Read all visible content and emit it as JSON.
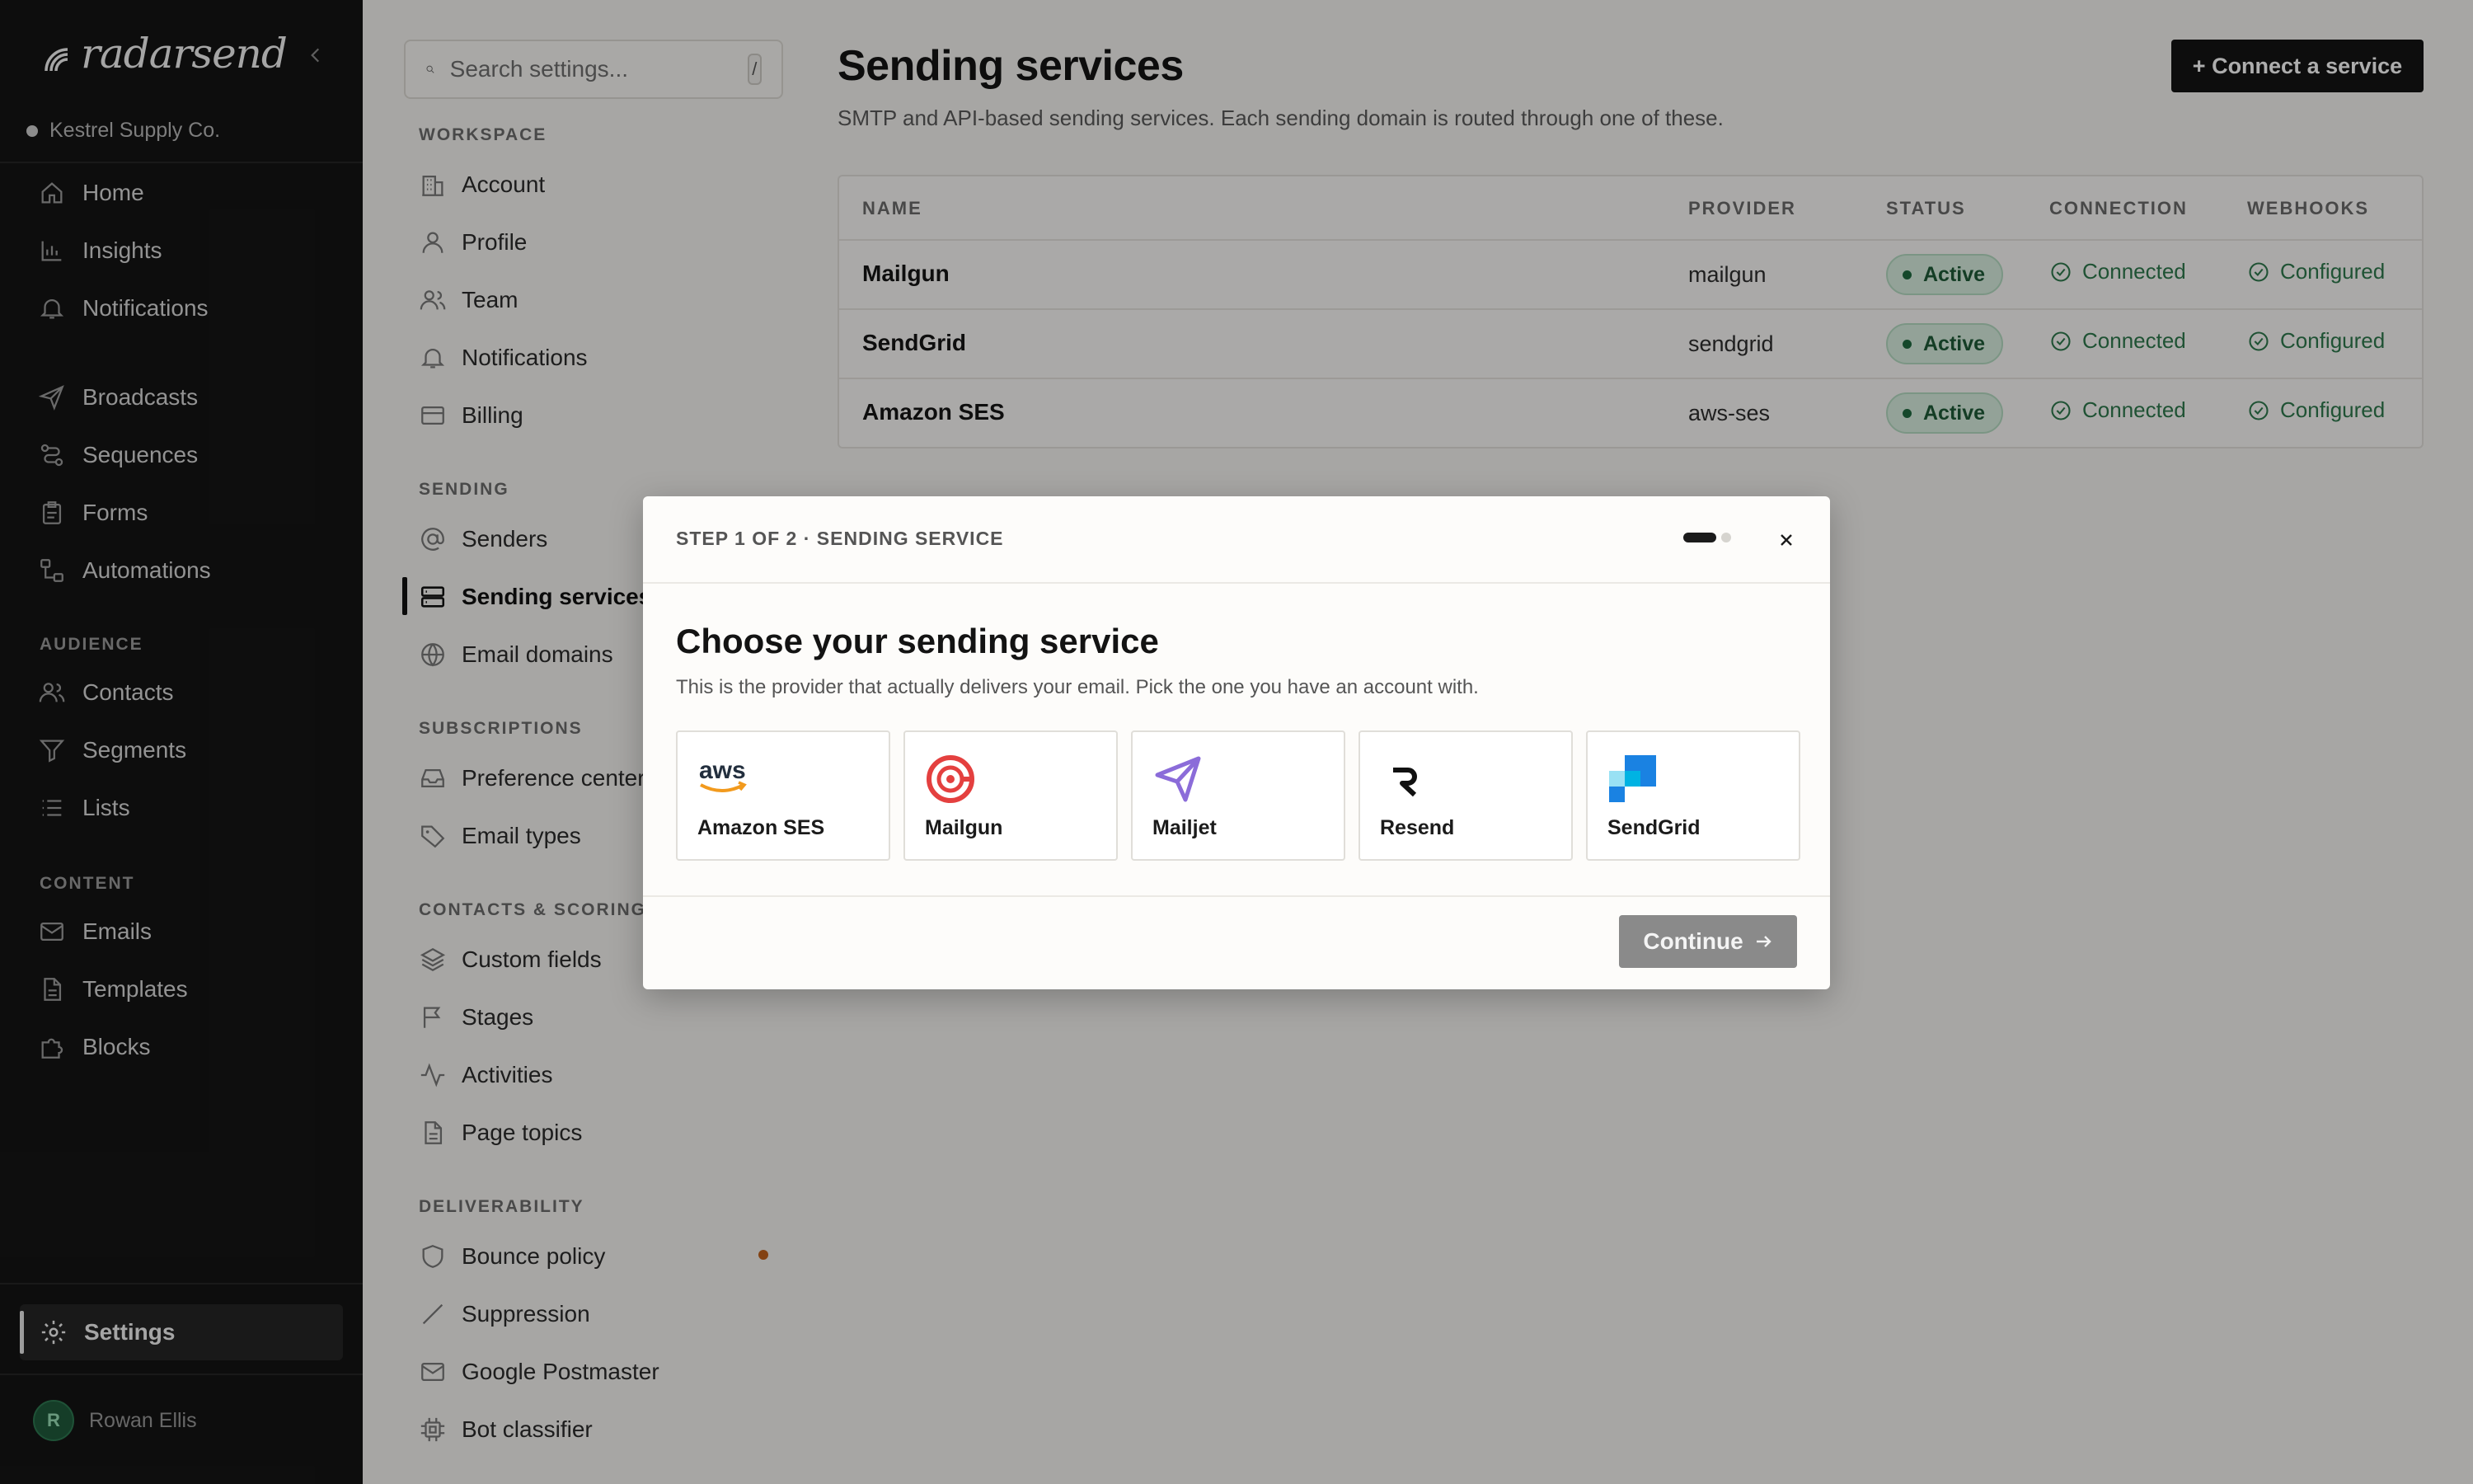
{
  "brand": {
    "name": "radarsend"
  },
  "workspace": {
    "name": "Kestrel Supply Co."
  },
  "nav": {
    "primary": [
      {
        "label": "Home",
        "icon": "home-icon"
      },
      {
        "label": "Insights",
        "icon": "bar-chart-icon"
      },
      {
        "label": "Notifications",
        "icon": "bell-icon"
      }
    ],
    "outreach": [
      {
        "label": "Broadcasts",
        "icon": "send-icon"
      },
      {
        "label": "Sequences",
        "icon": "sequence-icon"
      },
      {
        "label": "Forms",
        "icon": "clipboard-icon"
      },
      {
        "label": "Automations",
        "icon": "workflow-icon"
      }
    ],
    "audience_title": "AUDIENCE",
    "audience": [
      {
        "label": "Contacts",
        "icon": "users-icon"
      },
      {
        "label": "Segments",
        "icon": "filter-icon"
      },
      {
        "label": "Lists",
        "icon": "list-icon"
      }
    ],
    "content_title": "CONTENT",
    "content": [
      {
        "label": "Emails",
        "icon": "mail-icon"
      },
      {
        "label": "Templates",
        "icon": "file-icon"
      },
      {
        "label": "Blocks",
        "icon": "puzzle-icon"
      }
    ],
    "settings_label": "Settings"
  },
  "user": {
    "name": "Rowan Ellis",
    "initial": "R"
  },
  "settings_nav": {
    "search_placeholder": "Search settings...",
    "search_shortcut": "/",
    "workspace_title": "WORKSPACE",
    "workspace": [
      "Account",
      "Profile",
      "Team",
      "Notifications",
      "Billing"
    ],
    "sending_title": "SENDING",
    "sending": [
      "Senders",
      "Sending services",
      "Email domains"
    ],
    "subscriptions_title": "SUBSCRIPTIONS",
    "subscriptions": [
      "Preference center",
      "Email types"
    ],
    "contacts_title": "CONTACTS & SCORING",
    "contacts": [
      "Custom fields",
      "Stages",
      "Activities",
      "Page topics"
    ],
    "deliverability_title": "DELIVERABILITY",
    "deliverability": [
      "Bounce policy",
      "Suppression",
      "Google Postmaster",
      "Bot classifier"
    ]
  },
  "page": {
    "title": "Sending services",
    "subtitle": "SMTP and API-based sending services. Each sending domain is routed through one of these.",
    "connect_button": "+ Connect a service"
  },
  "table": {
    "columns": [
      "NAME",
      "PROVIDER",
      "STATUS",
      "CONNECTION",
      "WEBHOOKS"
    ],
    "rows": [
      {
        "name": "Mailgun",
        "provider": "mailgun",
        "status": "Active",
        "connection": "Connected",
        "webhooks": "Configured"
      },
      {
        "name": "SendGrid",
        "provider": "sendgrid",
        "status": "Active",
        "connection": "Connected",
        "webhooks": "Configured"
      },
      {
        "name": "Amazon SES",
        "provider": "aws-ses",
        "status": "Active",
        "connection": "Connected",
        "webhooks": "Configured"
      }
    ]
  },
  "modal": {
    "step": "STEP 1 OF 2 · SENDING SERVICE",
    "title": "Choose your sending service",
    "description": "This is the provider that actually delivers your email. Pick the one you have an account with.",
    "providers": [
      {
        "label": "Amazon SES",
        "logo_text": "aws",
        "icon": "aws-logo"
      },
      {
        "label": "Mailgun",
        "icon": "mailgun-logo"
      },
      {
        "label": "Mailjet",
        "icon": "mailjet-logo"
      },
      {
        "label": "Resend",
        "icon": "resend-logo"
      },
      {
        "label": "SendGrid",
        "icon": "sendgrid-logo"
      }
    ],
    "continue_label": "Continue",
    "step_progress": {
      "current": 1,
      "total": 2
    }
  },
  "colors": {
    "accent": "#141414",
    "status_green": "#1e5a37",
    "warning": "#c2621d",
    "mailgun": "#e4403f",
    "mailjet": "#8b6cd9",
    "sendgrid": "#1a82e2",
    "aws": "#f29a1d"
  }
}
